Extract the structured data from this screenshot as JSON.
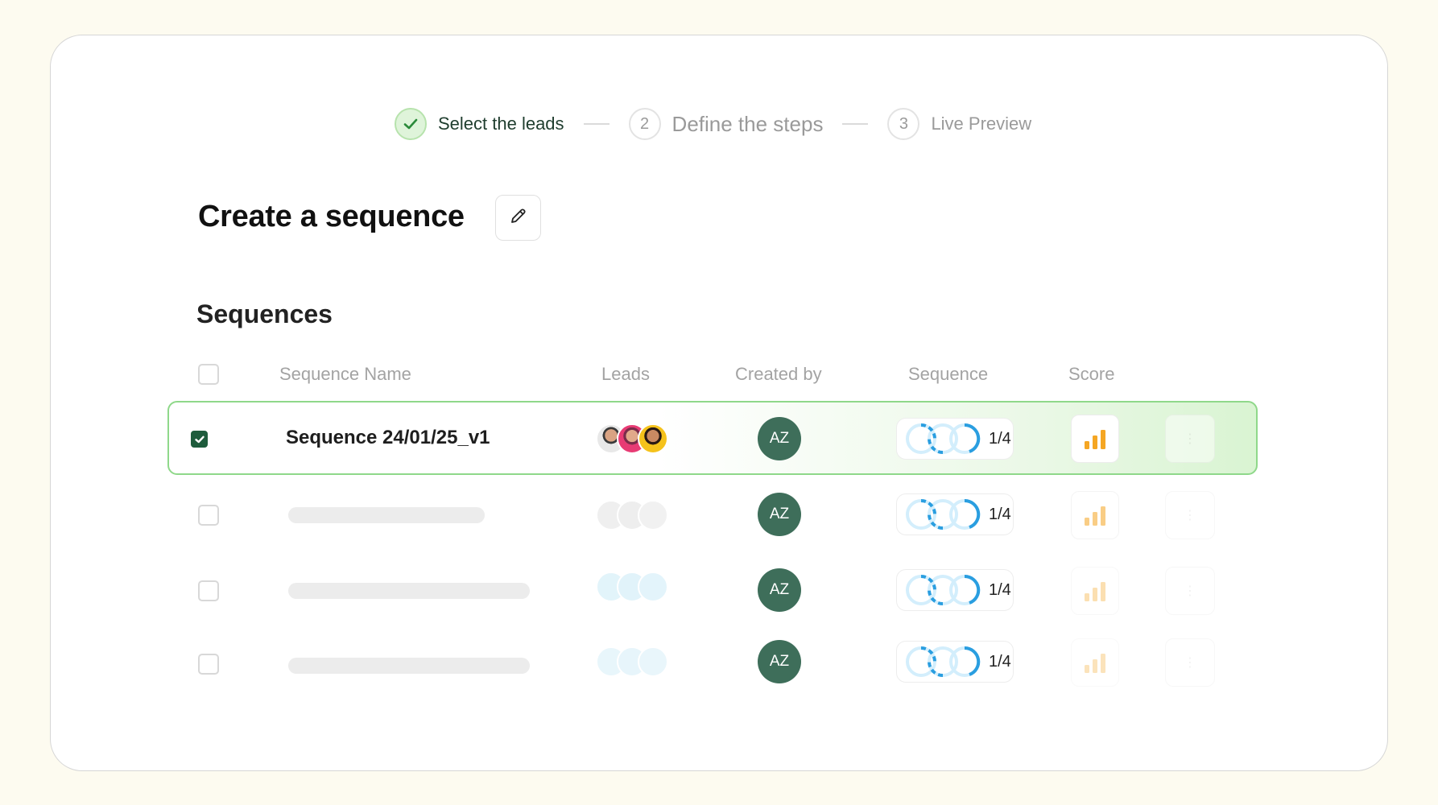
{
  "stepper": {
    "steps": [
      {
        "number": "",
        "label": "Select the leads",
        "state": "done"
      },
      {
        "number": "2",
        "label": "Define the steps",
        "state": "current"
      },
      {
        "number": "3",
        "label": "Live Preview",
        "state": "upcoming"
      }
    ]
  },
  "page": {
    "title": "Create a sequence",
    "edit_icon": "pencil-icon",
    "section_title": "Sequences"
  },
  "table": {
    "columns": [
      "Sequence Name",
      "Leads",
      "Created by",
      "Sequence",
      "Score"
    ],
    "rows": [
      {
        "name": "Sequence 24/01/25_v1",
        "created_by": "AZ",
        "sequence_progress": "1/4",
        "checked": true
      },
      {
        "name": "",
        "created_by": "AZ",
        "sequence_progress": "1/4",
        "checked": false
      },
      {
        "name": "",
        "created_by": "AZ",
        "sequence_progress": "1/4",
        "checked": false
      },
      {
        "name": "",
        "created_by": "AZ",
        "sequence_progress": "1/4",
        "checked": false
      }
    ]
  },
  "colors": {
    "accent_green": "#1e5c3c",
    "avatar_bg": "#3e6e5a",
    "score_orange": "#f5a623",
    "sequence_blue": "#2a9ee0"
  }
}
